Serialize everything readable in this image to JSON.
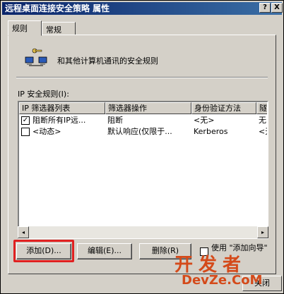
{
  "window": {
    "title": "远程桌面连接安全策略 属性",
    "help_btn": "?",
    "close_btn": "X"
  },
  "tabs": [
    {
      "label": "规则"
    },
    {
      "label": "常规"
    }
  ],
  "description": "和其他计算机通讯的安全规则",
  "list": {
    "label": "IP 安全规则(I):",
    "columns": [
      "IP 筛选器列表",
      "筛选器操作",
      "身份验证方法",
      "隧"
    ],
    "rows": [
      {
        "checked": true,
        "check_glyph": "✓",
        "cells": [
          "阻断所有IP远...",
          "阻断",
          "<无>",
          "无"
        ]
      },
      {
        "checked": false,
        "check_glyph": "",
        "cells": [
          "<动态>",
          "默认响应(仅限于...",
          "Kerberos",
          "<无"
        ]
      }
    ]
  },
  "buttons": {
    "add": "添加(D)...",
    "edit": "编辑(E)...",
    "delete": "删除(R)"
  },
  "use_wizard": "使用 \"添加向导\"",
  "close_label": "关闭",
  "watermark": {
    "line1": "开发者",
    "line2": "DevZe.CoM"
  },
  "icons": {
    "network": "network-computers-icon",
    "scroll_left": "◂",
    "scroll_right": "▸"
  }
}
